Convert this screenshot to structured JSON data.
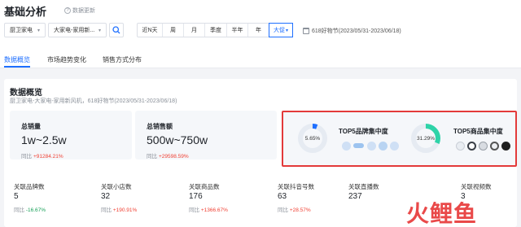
{
  "header": {
    "title": "基础分析",
    "update_label": "数据更新"
  },
  "filters": {
    "category1": "厨卫家电",
    "category2": "大家电-家用新...",
    "periods": [
      "近N天",
      "周",
      "月",
      "季度",
      "半年",
      "年",
      "大促"
    ],
    "active_period": "大促",
    "date_range": "618好物节(2023/05/31-2023/06/18)"
  },
  "tabs": [
    {
      "label": "数据概览",
      "active": true
    },
    {
      "label": "市场趋势变化",
      "active": false
    },
    {
      "label": "销售方式分布",
      "active": false
    }
  ],
  "overview": {
    "title": "数据概览",
    "subtitle": "厨卫家电-大家电-家用新风机，618好物节(2023/05/31-2023/06/18)"
  },
  "cards": [
    {
      "label": "总销量",
      "value": "1w~2.5w",
      "yoy_label": "同比",
      "yoy": "+91284.21%"
    },
    {
      "label": "总销售额",
      "value": "500w~750w",
      "yoy_label": "同比",
      "yoy": "+29598.59%"
    }
  ],
  "concentration": {
    "brand": {
      "title": "TOP5品牌集中度",
      "percent": "5.65%",
      "value": 5.65,
      "color": "#1e6fff"
    },
    "product": {
      "title": "TOP5商品集中度",
      "percent": "31.29%",
      "value": 31.29,
      "color": "#2ed3a8"
    }
  },
  "stats": [
    {
      "label": "关联品牌数",
      "value": "5",
      "yoy_label": "同比",
      "yoy": "-16.67%",
      "trend": "down"
    },
    {
      "label": "关联小店数",
      "value": "32",
      "yoy_label": "同比",
      "yoy": "+190.91%",
      "trend": "up"
    },
    {
      "label": "关联商品数",
      "value": "176",
      "yoy_label": "同比",
      "yoy": "+1366.67%",
      "trend": "up"
    },
    {
      "label": "关联抖音号数",
      "value": "63",
      "yoy_label": "同比",
      "yoy": "+28.57%",
      "trend": "up"
    },
    {
      "label": "关联直播数",
      "value": "237",
      "yoy_label": "",
      "yoy": "",
      "trend": "up"
    },
    {
      "label": "关联视频数",
      "value": "3",
      "yoy_label": "",
      "yoy": "",
      "trend": "up"
    }
  ],
  "watermark": "火鲤鱼"
}
